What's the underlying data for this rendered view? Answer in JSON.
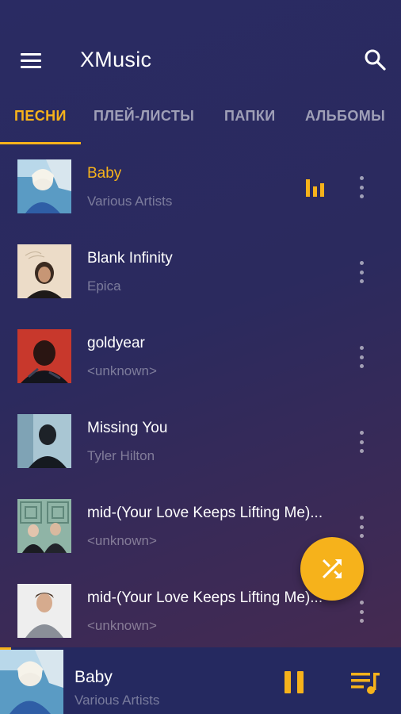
{
  "app": {
    "title": "XMusic"
  },
  "tabs": [
    "ПЕСНИ",
    "ПЛЕЙ-ЛИСТЫ",
    "ПАПКИ",
    "АЛЬБОМЫ"
  ],
  "songs": [
    {
      "title": "Baby",
      "artist": "Various Artists",
      "playing": true
    },
    {
      "title": "Blank Infinity",
      "artist": "Epica"
    },
    {
      "title": "goldyear",
      "artist": "<unknown>"
    },
    {
      "title": "Missing You",
      "artist": "Tyler Hilton"
    },
    {
      "title": "mid-(Your Love Keeps Lifting Me)...",
      "artist": "<unknown>"
    },
    {
      "title": "mid-(Your Love Keeps Lifting Me)...",
      "artist": "<unknown>"
    }
  ],
  "now_playing": {
    "title": "Baby",
    "artist": "Various Artists"
  },
  "icons": [
    "menu-icon",
    "search-icon",
    "equalizer-icon",
    "more-vert-icon",
    "shuffle-icon",
    "pause-icon",
    "queue-music-icon"
  ],
  "colors": {
    "accent": "#f6b21b",
    "background": "#2a2b63",
    "miniplayer": "#252960"
  }
}
